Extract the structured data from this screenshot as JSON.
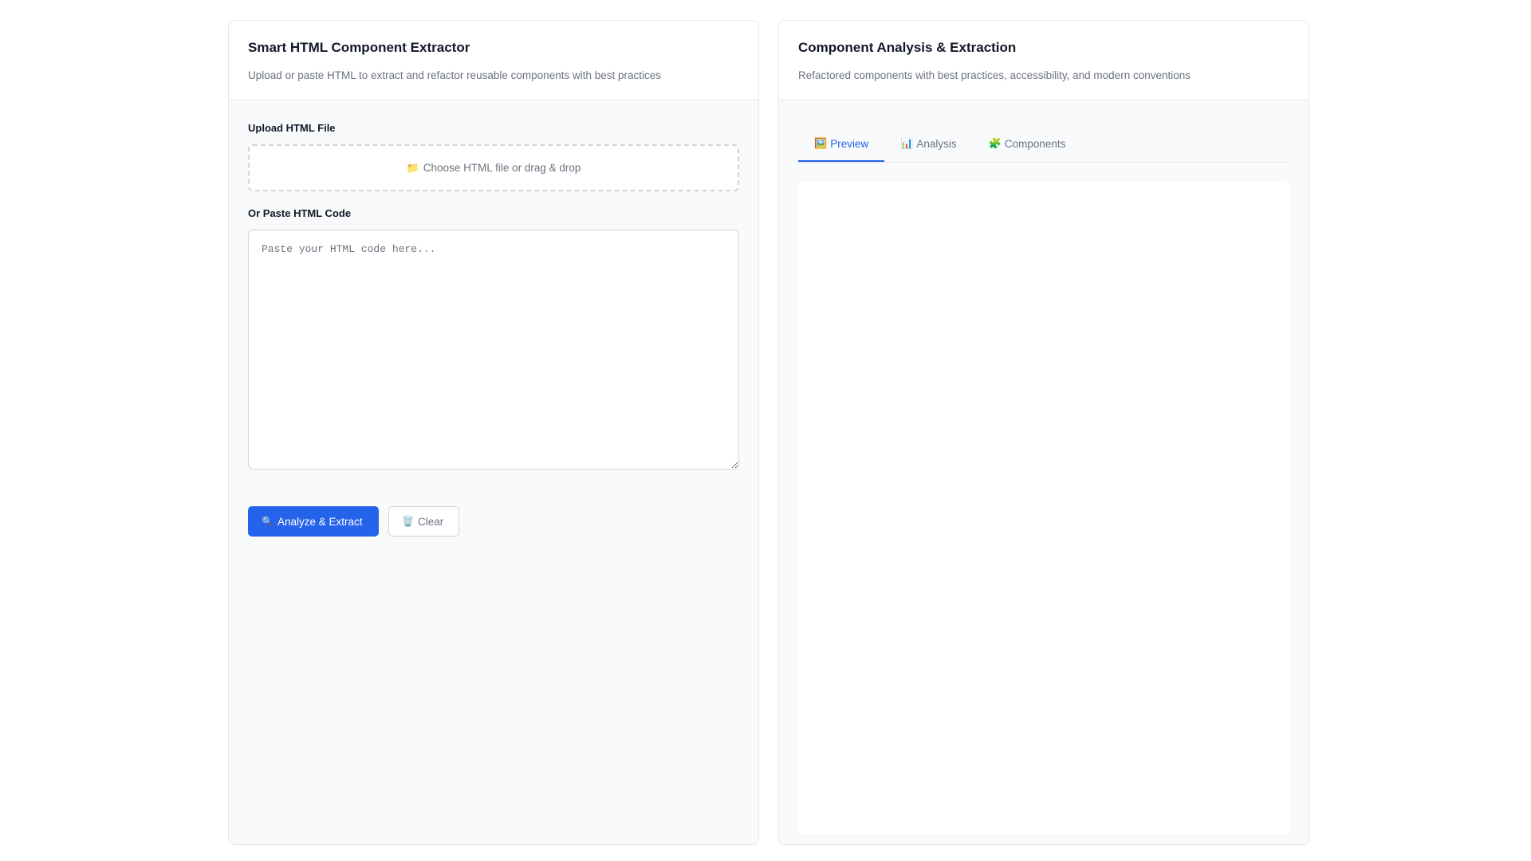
{
  "extractor": {
    "title": "Smart HTML Component Extractor",
    "subtitle": "Upload or paste HTML to extract and refactor reusable components with best practices",
    "upload_label": "Upload HTML File",
    "dropzone_icon": "folder-icon",
    "dropzone_text": "Choose HTML file or drag & drop",
    "paste_label": "Or Paste HTML Code",
    "code_value": "",
    "code_placeholder": "Paste your HTML code here...",
    "analyze_icon": "magnifier-icon",
    "analyze_label": "Analyze & Extract",
    "clear_icon": "trash-icon",
    "clear_label": "Clear"
  },
  "analysis": {
    "title": "Component Analysis & Extraction",
    "subtitle": "Refactored components with best practices, accessibility, and modern conventions",
    "tabs": [
      {
        "icon": "picture-icon",
        "label": "Preview",
        "active": true
      },
      {
        "icon": "bar-chart-icon",
        "label": "Analysis",
        "active": false
      },
      {
        "icon": "puzzle-icon",
        "label": "Components",
        "active": false
      }
    ]
  },
  "colors": {
    "accent": "#2563eb",
    "border": "#e5e7eb",
    "panel_bg": "#f9fafb",
    "muted_text": "#6b7280"
  }
}
